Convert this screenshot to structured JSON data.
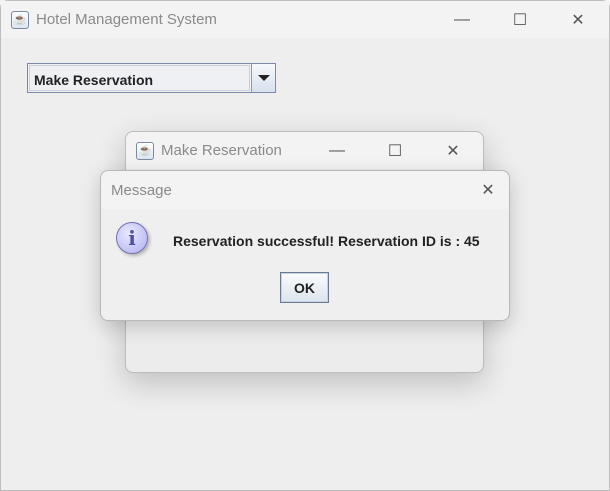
{
  "main_window": {
    "title": "Hotel Management System",
    "combo": {
      "selected": "Make Reservation"
    }
  },
  "child_window": {
    "title": "Make Reservation"
  },
  "dialog": {
    "title": "Message",
    "message": "Reservation successful! Reservation ID is : 45",
    "ok_label": "OK",
    "icon": "info-icon"
  }
}
